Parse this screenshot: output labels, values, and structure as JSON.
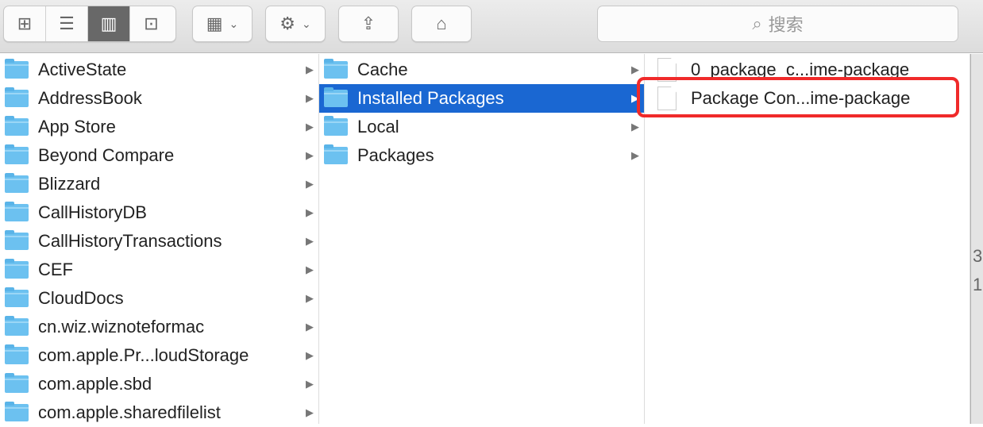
{
  "toolbar": {
    "view_icons": [
      "icon-view",
      "list-view",
      "column-view",
      "coverflow-view"
    ],
    "active_view": "column-view",
    "search_placeholder": "搜索"
  },
  "columns": [
    {
      "items": [
        {
          "label": "ActiveState"
        },
        {
          "label": "AddressBook"
        },
        {
          "label": "App Store"
        },
        {
          "label": "Beyond Compare"
        },
        {
          "label": "Blizzard"
        },
        {
          "label": "CallHistoryDB"
        },
        {
          "label": "CallHistoryTransactions"
        },
        {
          "label": "CEF"
        },
        {
          "label": "CloudDocs"
        },
        {
          "label": "cn.wiz.wiznoteformac"
        },
        {
          "label": "com.apple.Pr...loudStorage"
        },
        {
          "label": "com.apple.sbd"
        },
        {
          "label": "com.apple.sharedfilelist"
        }
      ]
    },
    {
      "items": [
        {
          "label": "Cache"
        },
        {
          "label": "Installed Packages",
          "selected": true
        },
        {
          "label": "Local"
        },
        {
          "label": "Packages"
        }
      ]
    },
    {
      "items": [
        {
          "label": "0_package_c...ime-package"
        },
        {
          "label": "Package Con...ime-package",
          "highlighted": true
        }
      ]
    }
  ],
  "background_window": {
    "digits": [
      "3",
      "1"
    ]
  },
  "colors": {
    "selection": "#1a67d2",
    "highlight_box": "#f02a2a",
    "folder": "#6cc1f0"
  }
}
